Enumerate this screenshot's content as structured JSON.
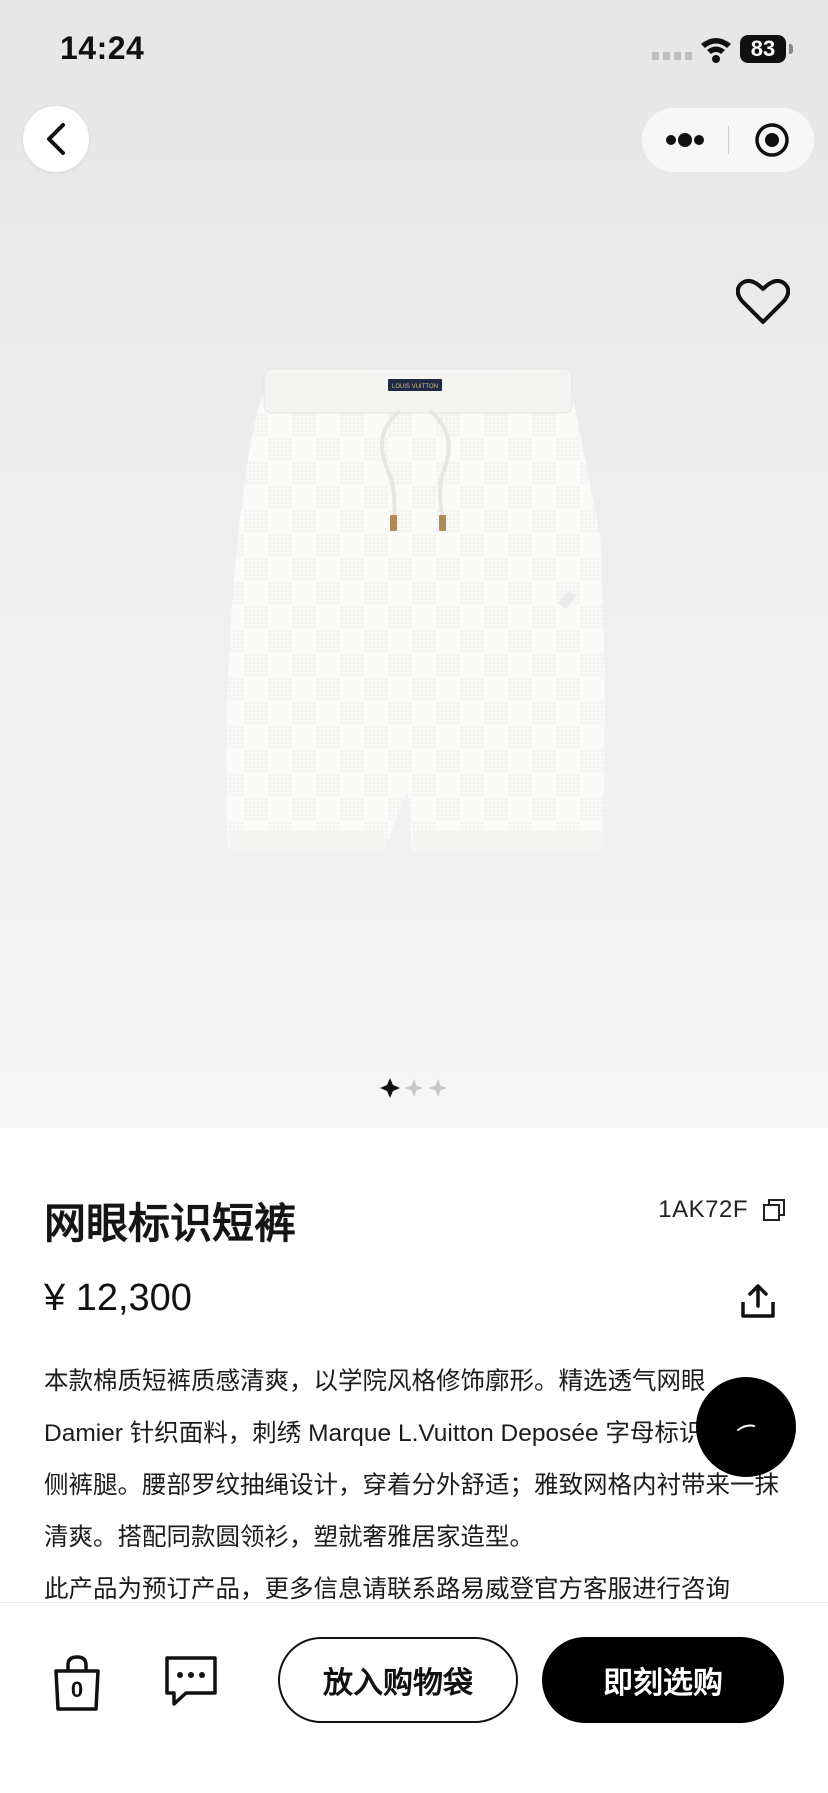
{
  "status_bar": {
    "time": "14:24",
    "battery": "83",
    "icons": [
      "signal-icon",
      "wifi-icon",
      "battery-icon"
    ]
  },
  "nav": {
    "icons": [
      "chevron-left-icon",
      "more-dots-icon",
      "target-icon"
    ]
  },
  "gallery": {
    "image_subject": "white knit mesh drawstring shorts with checkerboard pattern",
    "waistband_tag": "LOUIS VUITTON",
    "current_index": 1,
    "total_images": 3,
    "wishlist_icon": "heart-outline-icon"
  },
  "product": {
    "title": "网眼标识短裤",
    "sku": "1AK72F",
    "price": "¥ 12,300",
    "description": "本款棉质短裤质感清爽，以学院风格修饰廓形。精选透气网眼 Damier 针织面料，刺绣 Marque L.Vuitton Deposée 字母标识点睛左侧裤腿。腰部罗纹抽绳设计，穿着分外舒适；雅致网格内衬带来一抹清爽。搭配同款圆领衫，塑就奢雅居家造型。",
    "preorder_note": "此产品为预订产品，更多信息请联系路易威登官方客服进行咨询"
  },
  "bottom_bar": {
    "bag_count": "0",
    "add_to_bag_label": "放入购物袋",
    "buy_now_label": "即刻选购"
  },
  "colors": {
    "accent": "#000000",
    "hero_bg": "#ececec"
  }
}
